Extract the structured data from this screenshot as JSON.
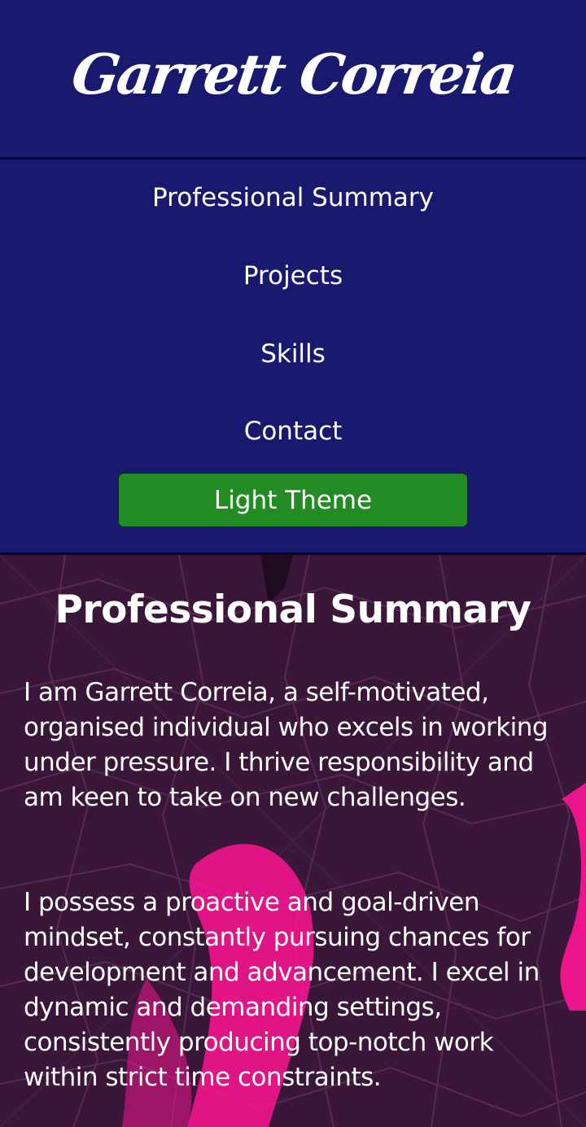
{
  "header": {
    "site_title": "Garrett Correia"
  },
  "nav": {
    "items": [
      {
        "label": "Professional Summary"
      },
      {
        "label": "Projects"
      },
      {
        "label": "Skills"
      },
      {
        "label": "Contact"
      }
    ],
    "theme_button_label": "Light Theme"
  },
  "main": {
    "section_title": "Professional Summary",
    "paragraphs": [
      "I am Garrett Correia, a self-motivated, organised individual who excels in working under pressure. I thrive responsibility and am keen to take on new challenges.",
      "I possess a proactive and goal-driven mindset, constantly pursuing chances for development and advancement. I excel in dynamic and demanding settings, consistently producing top-notch work within strict time constraints."
    ]
  },
  "colors": {
    "header_background": "#191970",
    "divider": "#050525",
    "theme_button": "#238b23",
    "main_background": "#3a1638",
    "accent_pink": "#ff1493",
    "text": "#ffffff"
  }
}
